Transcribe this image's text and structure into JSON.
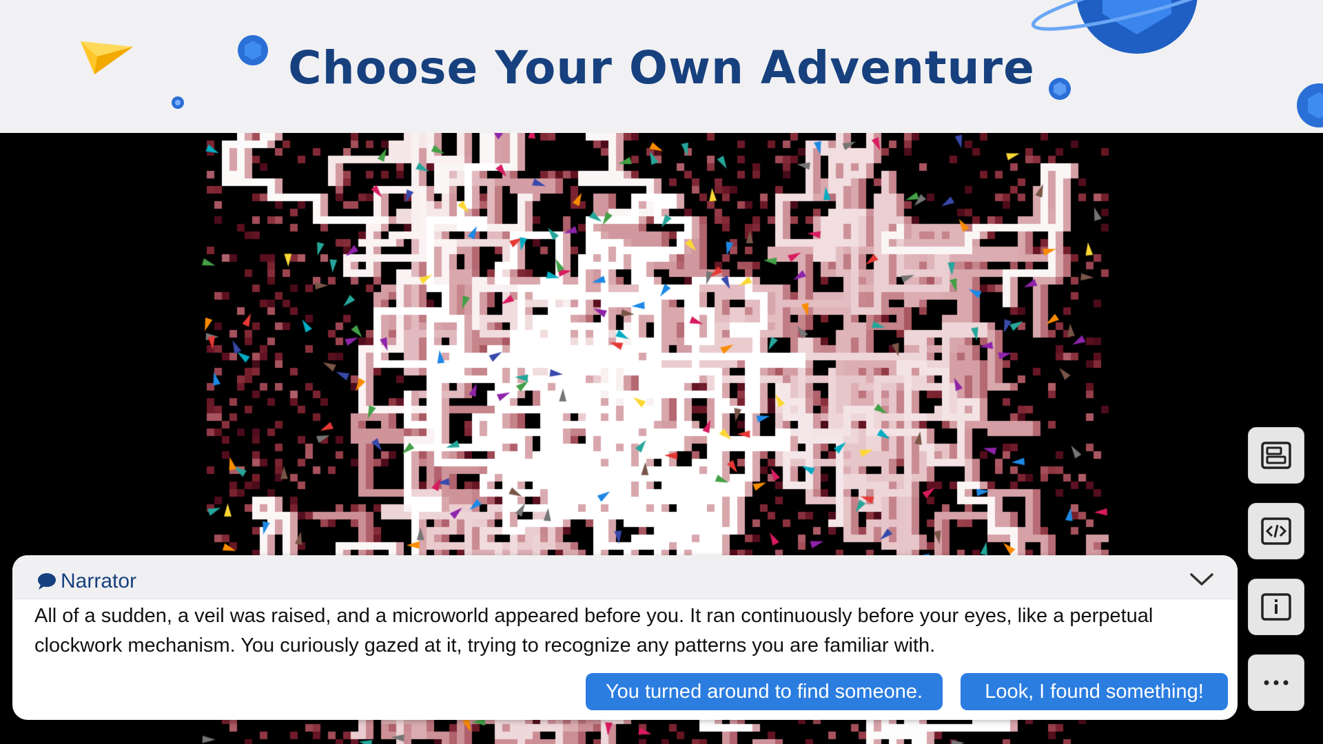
{
  "header": {
    "title": "Choose Your Own Adventure"
  },
  "narrator": {
    "speaker": "Narrator",
    "text": "All of a sudden, a veil was raised, and a microworld appeared before you. It ran continuously before your eyes, like a perpetual clockwork mechanism. You curiously gazed at it, trying to recognize any patterns you are familiar with.",
    "choices": [
      "You turned around to find someone.",
      "Look, I found something!"
    ]
  },
  "toolbar": {
    "buttons": [
      "layout-icon",
      "code-icon",
      "info-icon",
      "more-icon"
    ]
  },
  "colors": {
    "title": "#17407e",
    "button": "#2b7de0",
    "header_bg": "#f1f1f3",
    "trail": "#f4c3cc",
    "agents": [
      "#e53935",
      "#1e88e5",
      "#43a047",
      "#fdd835",
      "#8e24aa",
      "#00acc1",
      "#fb8c00",
      "#d81b60",
      "#795548",
      "#757575",
      "#3949ab",
      "#26a69a"
    ]
  }
}
